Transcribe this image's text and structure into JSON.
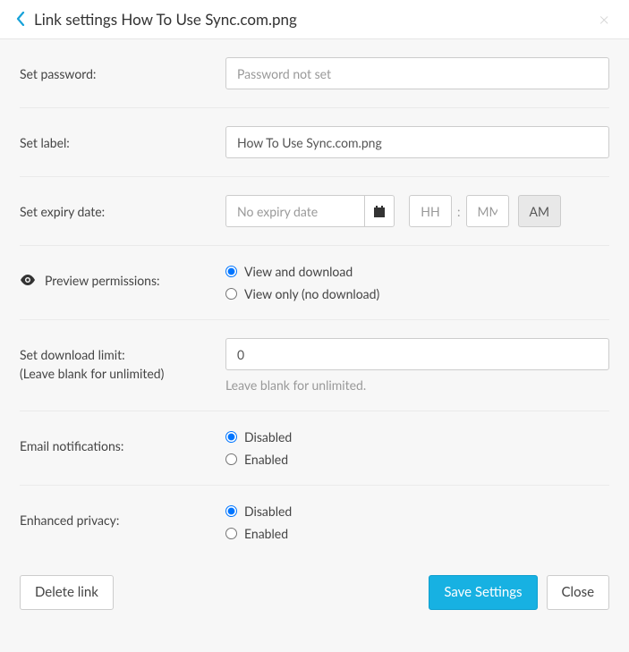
{
  "header": {
    "title": "Link settings How To Use Sync.com.png"
  },
  "fields": {
    "password": {
      "label": "Set password:",
      "placeholder": "Password not set",
      "value": ""
    },
    "label": {
      "label": "Set label:",
      "value": "How To Use Sync.com.png"
    },
    "expiry": {
      "label": "Set expiry date:",
      "date_placeholder": "No expiry date",
      "date_value": "",
      "hh_placeholder": "HH",
      "hh_value": "",
      "mm_placeholder": "MM",
      "mm_value": "",
      "ampm": "AM"
    },
    "preview": {
      "label": "Preview permissions:",
      "options": {
        "view_download": "View and download",
        "view_only": "View only (no download)"
      }
    },
    "download_limit": {
      "label_line1": "Set download limit:",
      "label_line2": "(Leave blank for unlimited)",
      "value": "0",
      "help": "Leave blank for unlimited."
    },
    "email_notifications": {
      "label": "Email notifications:",
      "options": {
        "disabled": "Disabled",
        "enabled": "Enabled"
      }
    },
    "enhanced_privacy": {
      "label": "Enhanced privacy:",
      "options": {
        "disabled": "Disabled",
        "enabled": "Enabled"
      }
    }
  },
  "buttons": {
    "delete": "Delete link",
    "save": "Save Settings",
    "close": "Close"
  }
}
